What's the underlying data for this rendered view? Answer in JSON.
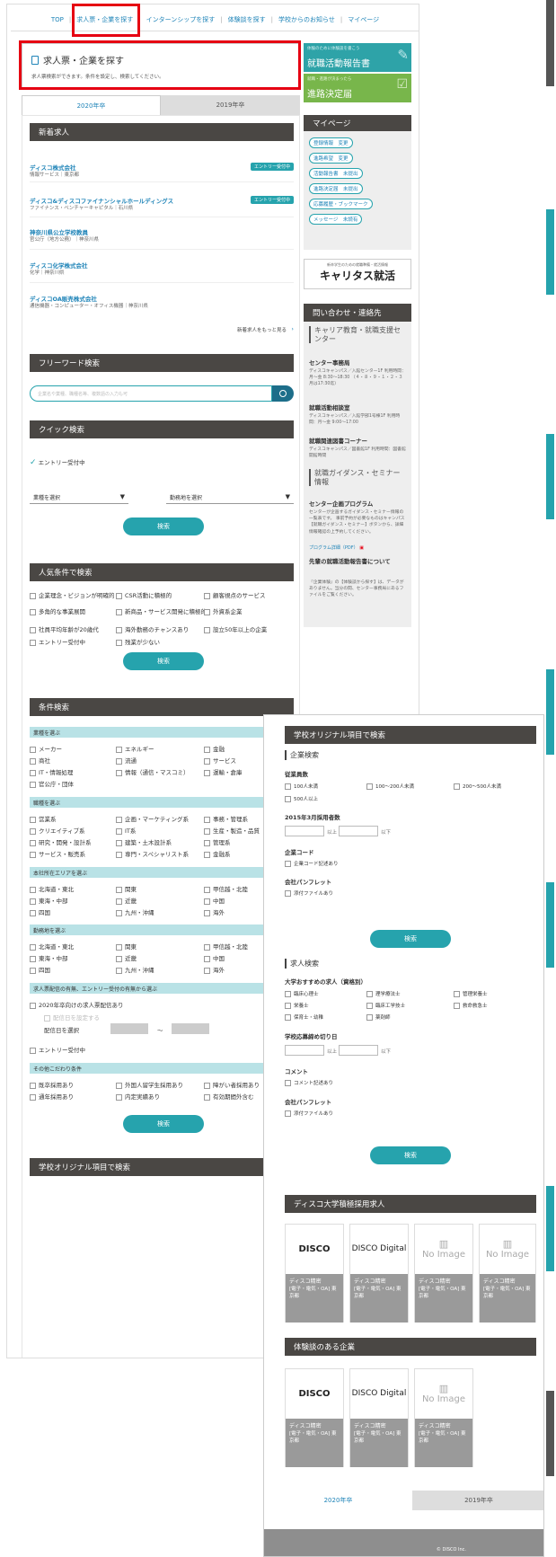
{
  "nav": {
    "items": [
      "TOP",
      "求人票・企業を探す",
      "インターンシップを探す",
      "体験談を探す",
      "学校からのお知らせ",
      "マイページ"
    ]
  },
  "page": {
    "title": "求人票・企業を探す",
    "subtitle": "求人票検索ができます。条件を設定し、検索してください。"
  },
  "tabs": {
    "tab1": "2020年卒",
    "tab2": "2019年卒"
  },
  "new_jobs": {
    "title": "新着求人",
    "more": "新着求人をもっと見る",
    "items": [
      {
        "name": "ディスコ株式会社",
        "sub": "情報サービス｜東京都",
        "badge": "エントリー受付中"
      },
      {
        "name": "ディスコ&ディスコファイナンシャルホールディングス",
        "sub": "ファイナンス・ベンチャーキャピタル｜石川県",
        "badge": "エントリー受付中"
      },
      {
        "name": "神奈川県公立学校教員",
        "sub": "官公庁（地方公務）｜神奈川県",
        "badge": ""
      },
      {
        "name": "ディスコ化学株式会社",
        "sub": "化学｜神奈川県",
        "badge": ""
      },
      {
        "name": "ディスコOA販売株式会社",
        "sub": "通信機器・コンピューター・オフィス機器｜神奈川県",
        "badge": ""
      }
    ]
  },
  "freeword": {
    "title": "フリーワード検索",
    "placeholder": "企業名や業種、職種名等、複数語の入力も可"
  },
  "quick": {
    "title": "クイック検索",
    "entry": "エントリー受付中",
    "industry": "業種を選択",
    "location": "勤務地を選択",
    "search": "検索"
  },
  "popular": {
    "title": "人気条件で検索",
    "items": [
      "企業理念・ビジョンが明確的",
      "CSR活動に積極的",
      "顧客視点のサービス",
      "多角的な事業展開",
      "新商品・サービス開発に積極的",
      "外資系企業",
      "社員平均年齢が20歳代",
      "海外勤務のチャンスあり",
      "設立50年以上の企業",
      "エントリー受付中",
      "残業が少ない"
    ],
    "search": "検索"
  },
  "cond": {
    "title": "条件検索",
    "industry_label": "業種を選ぶ",
    "industry": [
      "メーカー",
      "エネルギー",
      "金融",
      "商社",
      "流通",
      "サービス",
      "IT・情報処理",
      "情報（通信・マスコミ）",
      "運輸・倉庫",
      "官公庁・団体"
    ],
    "job_label": "職種を選ぶ",
    "job": [
      "営業系",
      "企画・マーケティング系",
      "事務・管理系",
      "クリエイティブ系",
      "IT系",
      "生産・製造・品質",
      "研究・開発・設計系",
      "建築・土木設計系",
      "管理系",
      "サービス・販売系",
      "専門・スペシャリスト系",
      "金融系"
    ],
    "area_label": "本社所在エリアを選ぶ",
    "area": [
      "北海道・東北",
      "関東",
      "甲信越・北陸",
      "東海・中部",
      "近畿",
      "中国",
      "四国",
      "九州・沖縄",
      "海外"
    ],
    "work_label": "勤務地を選ぶ",
    "work": [
      "北海道・東北",
      "関東",
      "甲信越・北陸",
      "東海・中部",
      "近畿",
      "中国",
      "四国",
      "九州・沖縄",
      "海外"
    ],
    "pub_label": "求人票配信の有無、エントリー受付の有無から選ぶ",
    "pub1": "2020年卒向けの求人票配信あり",
    "pub2": "配信日を設定する",
    "pub3": "配信日を選択",
    "pub4": "エントリー受付中",
    "tilde": "〜",
    "other_label": "その他こだわり条件",
    "other": [
      "既卒採用あり",
      "外国人留学生採用あり",
      "障がい者採用あり",
      "通年採用あり",
      "内定実績あり",
      "有効期間外含む"
    ],
    "search": "検索"
  },
  "school_bottom": "学校オリジナル項目で検索",
  "side": {
    "banner1_top": "体験のために体験談を書こう",
    "banner1": "就職活動報告書",
    "banner2_top": "就職・進路が決まったら",
    "banner2": "進路決定届",
    "mypage_title": "マイページ",
    "mypage": [
      "登録情報　変更",
      "進路希望　変更",
      "活動報告書　未提出",
      "進路決定届　未提出",
      "応募履歴・ブックマーク",
      "メッセージ　未読有"
    ],
    "caritas_top": "新卒学生のための就職準備・就活情報",
    "caritas": "キャリタス就活",
    "contact_title": "問い合わせ・連絡先",
    "center": "キャリア教育・就職支援センター",
    "office": "センター事務局",
    "office_text": "ディスコキャンパス／入館センター1F 利用時間：月〜金 8:30〜18:30 （４・８・９・１・２・３月は17:30迄）",
    "room": "就職活動相談室",
    "room_text": "ディスコキャンパス／入館学部1号棟1F 利用時間：月〜金 9:00〜17:00",
    "corner": "就職関連図書コーナー",
    "corner_text": "ディスコキャンパス／図書館1F 利用時間：図書館開館時間",
    "guidance": "就職ガイダンス・セミナー情報",
    "plan": "センター企画プログラム",
    "plan_text": "センターが企画するガイダンス・セミナー情報の一覧表です。 事前予約が必要なものはキャンパス【就職ガイダンス・セミナー】ボタンから、詳細情報確認の上予約してください。",
    "pdf": "プログラム詳細（PDF）",
    "past": "先輩の就職活動報告書について",
    "past_text": "『企業体験』の【体験談から探す】は、データがありません。当分の間、センター事務局にあるファイルをご覧ください。"
  },
  "school": {
    "title": "学校オリジナル項目で検索",
    "company_section": "企業検索",
    "employees_label": "従業員数",
    "employees": [
      "100人未満",
      "100〜200人未満",
      "200〜500人未満",
      "500人以上"
    ],
    "hires_label": "2015年3月採用者数",
    "above": "以上",
    "below": "以下",
    "code_label": "企業コード",
    "code": "企業コード記述あり",
    "pamphlet_label": "会社パンフレット",
    "pamphlet": "添付ファイルあり",
    "search": "検索",
    "job_section": "求人検索",
    "recommend_label": "大学おすすめの求人（資格別）",
    "recommend": [
      "臨床心理士",
      "理学療法士",
      "管理栄養士",
      "栄養士",
      "臨床工学技士",
      "救命救急士",
      "保育士・幼稚",
      "薬剤師"
    ],
    "deadline_label": "学校応募締め切り日",
    "comment_label": "コメント",
    "comment": "コメント記述あり",
    "pamphlet2_label": "会社パンフレット",
    "pamphlet2": "添付ファイルあり",
    "search2": "検索"
  },
  "disco_pos": {
    "title": "ディスコ大学積極採用求人",
    "cards": [
      {
        "logo": "DISCO",
        "name": "ディスコ精密",
        "meta": "[電子・電気・OA] 東京都"
      },
      {
        "logo": "DISCO Digital",
        "name": "ディスコ精密",
        "meta": "[電子・電気・OA] 東京都"
      },
      {
        "logo": "No Image",
        "name": "ディスコ精密",
        "meta": "[電子・電気・OA] 東京都"
      },
      {
        "logo": "No Image",
        "name": "ディスコ精密",
        "meta": "[電子・電気・OA] 東京都"
      }
    ]
  },
  "experience": {
    "title": "体験談のある企業",
    "cards": [
      {
        "logo": "DISCO",
        "name": "ディスコ精密",
        "meta": "[電子・電気・OA] 東京都"
      },
      {
        "logo": "DISCO Digital",
        "name": "ディスコ精密",
        "meta": "[電子・電気・OA] 東京都"
      },
      {
        "logo": "No Image",
        "name": "ディスコ精密",
        "meta": "[電子・電気・OA] 東京都"
      }
    ]
  },
  "footer_tabs": {
    "tab1": "2020年卒",
    "tab2": "2019年卒"
  },
  "copyright": "© DISCO Inc."
}
